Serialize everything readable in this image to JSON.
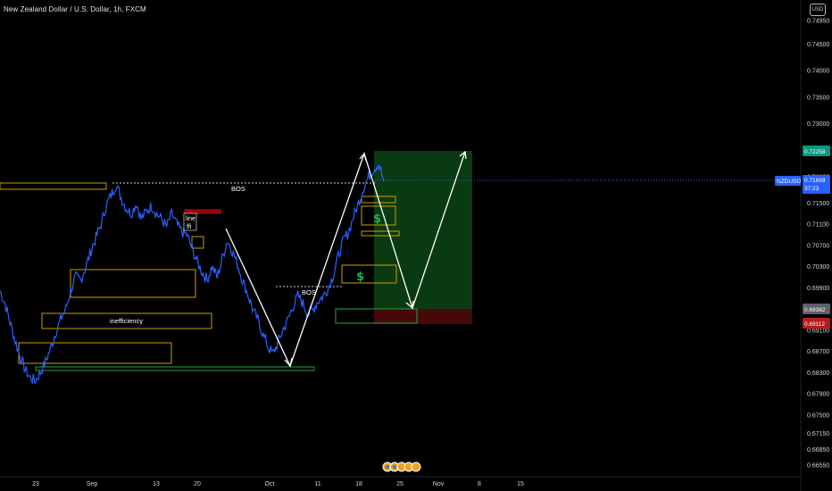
{
  "header": {
    "symbol_title": "New Zealand Dollar / U.S. Dollar, 1h, FXCM",
    "currency_label": "USD"
  },
  "colors": {
    "background": "#000000",
    "price_line": "#2962ff",
    "current_price_tag": "#2962ff",
    "target_tag": "#089981",
    "stop_tag": "#b71c1c",
    "entry_tag": "#5d606b",
    "profit_zone": "#0b3d13",
    "loss_zone": "#4a0a0a",
    "zone_outline": "#c9a000",
    "green_outline": "#2ea043",
    "arrow": "#ffffff"
  },
  "chart_data": {
    "type": "line",
    "title": "New Zealand Dollar / U.S. Dollar, 1h, FXCM",
    "xlabel": "",
    "ylabel": "",
    "ylim": [
      0.664,
      0.752
    ],
    "y_ticks": [
      "0.74950",
      "0.74500",
      "0.74000",
      "0.73500",
      "0.73000",
      "0.72500",
      "0.72000",
      "0.71500",
      "0.71100",
      "0.70700",
      "0.70300",
      "0.69900",
      "0.69500",
      "0.69100",
      "0.68700",
      "0.68300",
      "0.67900",
      "0.67500",
      "0.67150",
      "0.66850",
      "0.66550"
    ],
    "x_ticks": [
      "23",
      "Sep",
      "13",
      "20",
      "Oct",
      "11",
      "18",
      "25",
      "Nov",
      "8",
      "15"
    ],
    "grid": false,
    "series": [
      {
        "values": [
          0.6985,
          0.696,
          0.6925,
          0.689,
          0.686,
          0.6835,
          0.682,
          0.6815,
          0.683,
          0.685,
          0.6875,
          0.6905,
          0.693,
          0.695,
          0.6985,
          0.701,
          0.7005,
          0.703,
          0.706,
          0.7085,
          0.711,
          0.7145,
          0.7165,
          0.7185,
          0.716,
          0.714,
          0.713,
          0.715,
          0.712,
          0.7135,
          0.7145,
          0.713,
          0.712,
          0.7105,
          0.713,
          0.711,
          0.7095,
          0.709,
          0.7065,
          0.704,
          0.702,
          0.7005,
          0.703,
          0.701,
          0.7045,
          0.708,
          0.706,
          0.7035,
          0.7005,
          0.698,
          0.695,
          0.693,
          0.6905,
          0.688,
          0.6865,
          0.6885,
          0.691,
          0.693,
          0.6955,
          0.6975,
          0.696,
          0.694,
          0.695,
          0.6965,
          0.6975,
          0.699,
          0.7015,
          0.705,
          0.708,
          0.7095,
          0.7125,
          0.715,
          0.718,
          0.72,
          0.7215,
          0.7225,
          0.719
        ]
      }
    ],
    "annotations": {
      "bos_labels": [
        "BOS",
        "BOS"
      ],
      "inefficiency_label": "inefficiency",
      "small_box_lines": [
        "line",
        "ffi"
      ],
      "dollar_signs": [
        "$",
        "$"
      ],
      "arrows": "zigzag projection: down-up-down-up"
    },
    "price_tags": [
      {
        "value": "0.72258",
        "kind": "target"
      },
      {
        "value": "0.71699",
        "kind": "current",
        "symbol": "NZDUSD",
        "countdown": "37:23"
      },
      {
        "value": "0.69382",
        "kind": "entry"
      },
      {
        "value": "0.69112",
        "kind": "stop"
      }
    ]
  }
}
